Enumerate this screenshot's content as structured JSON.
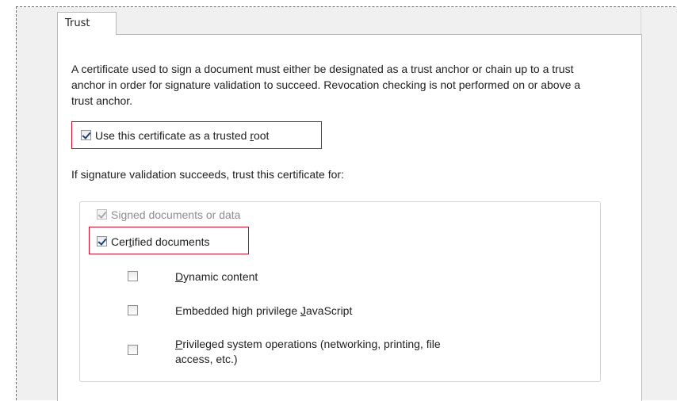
{
  "tab": {
    "label": "Trust"
  },
  "description": "A certificate used to sign a document must either be designated as a trust anchor or chain up to a trust anchor in order for signature validation to succeed.  Revocation checking is not performed on or above a trust anchor.",
  "trusted_root": {
    "pre": "Use this certificate as a trusted ",
    "key": "r",
    "post": "oot",
    "checked": true
  },
  "trust_for_label": "If signature validation succeeds, trust this certificate for:",
  "signed_docs": {
    "label": "Signed documents or data",
    "checked": true,
    "disabled": true
  },
  "certified_docs": {
    "pre": "Cer",
    "key": "t",
    "post": "ified documents",
    "checked": true
  },
  "dynamic_content": {
    "pre": "",
    "key": "D",
    "post": "ynamic content",
    "checked": false
  },
  "high_privilege_js": {
    "pre": "Embedded high privilege ",
    "key": "J",
    "post": "avaScript",
    "checked": false
  },
  "privileged_ops": {
    "key": "P",
    "post_line1": "rivileged system operations (networking, printing, file",
    "line2": "access, etc.)",
    "checked": false
  },
  "colors": {
    "highlight": "#c8102e",
    "checkmark": "#1d3f7a"
  }
}
